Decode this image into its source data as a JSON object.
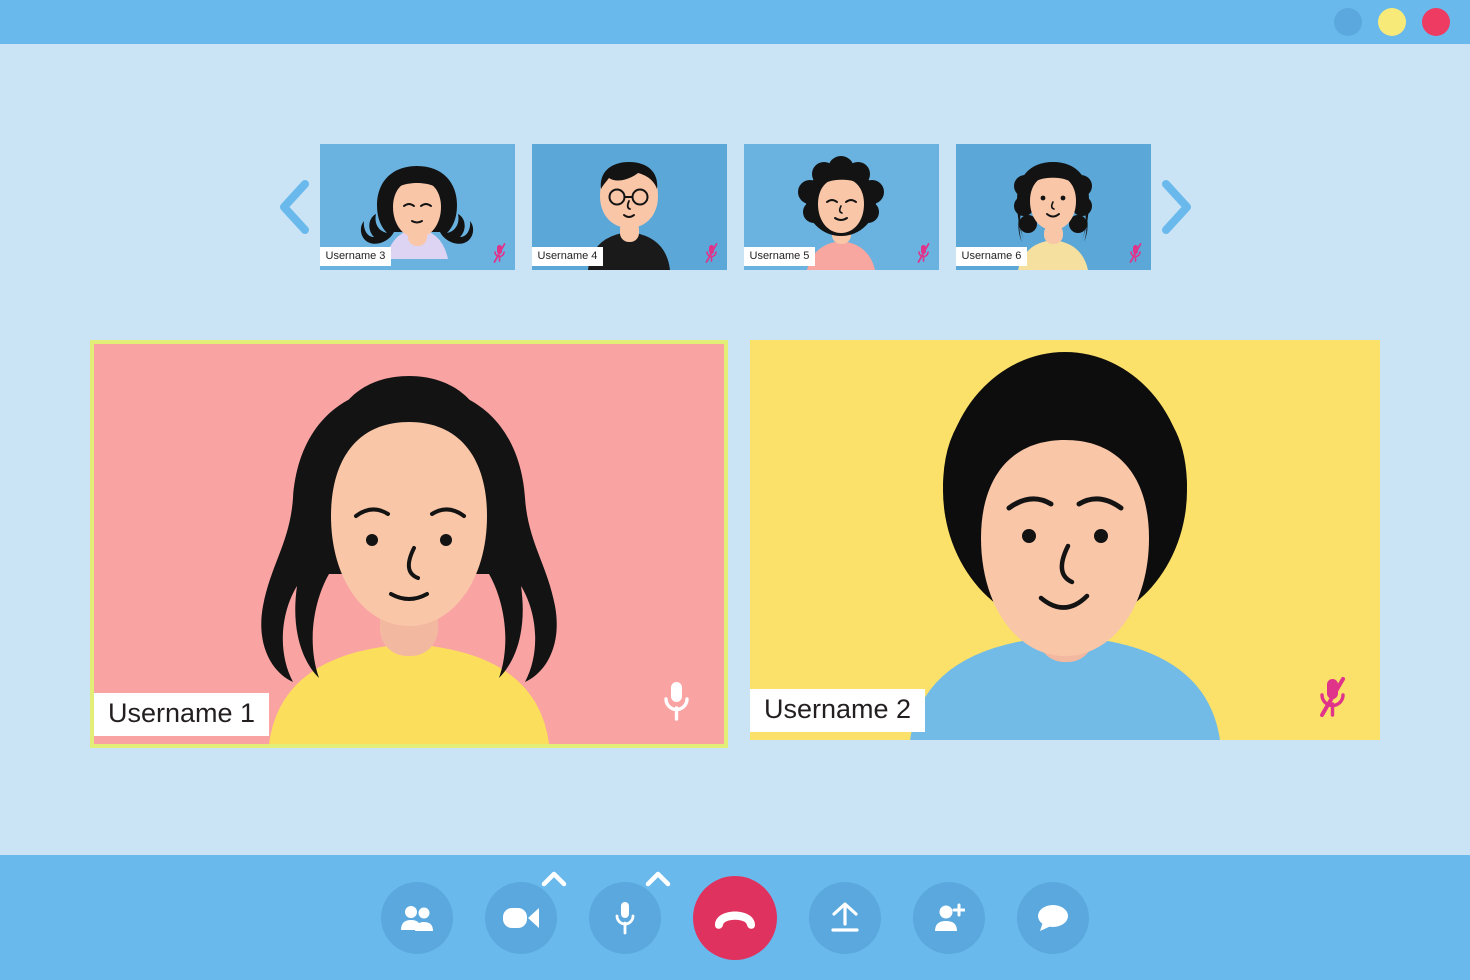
{
  "window": {
    "titlebar_color": "#6ab9ec",
    "body_color": "#cbe4f5",
    "controls": [
      {
        "name": "minimize",
        "color": "#5aa8dd"
      },
      {
        "name": "maximize",
        "color": "#f8ea78"
      },
      {
        "name": "close",
        "color": "#ed3b62"
      }
    ]
  },
  "strip": {
    "prev_label": "chevron-left",
    "next_label": "chevron-right",
    "arrow_color": "#6ab9ec",
    "thumbnails": [
      {
        "label": "Username 3",
        "bg": "#6ab2e0",
        "hair": "curly-long",
        "shirt": "#ddd3f3",
        "eyes": "closed",
        "muted": true
      },
      {
        "label": "Username 4",
        "bg": "#5ba7d8",
        "hair": "short-glasses",
        "shirt": "#1a1a1a",
        "eyes": "open",
        "muted": true
      },
      {
        "label": "Username 5",
        "bg": "#6ab2e0",
        "hair": "afro",
        "shirt": "#f7a7a0",
        "eyes": "closed",
        "muted": true
      },
      {
        "label": "Username 6",
        "bg": "#5ba7d8",
        "hair": "curly-long",
        "shirt": "#f6e0a0",
        "eyes": "open",
        "muted": true
      }
    ]
  },
  "stage": {
    "tiles": [
      {
        "label": "Username 1",
        "bg": "#f9a3a3",
        "shirt": "#fbdf5c",
        "hair": "wavy-long",
        "muted": false,
        "active": true,
        "active_border": "#e2ee78",
        "mic_color": "#ffffff"
      },
      {
        "label": "Username 2",
        "bg": "#fbe06a",
        "shirt": "#71bbe6",
        "hair": "bob",
        "muted": true,
        "active": false,
        "mic_color": "#e0338a"
      }
    ]
  },
  "toolbar": {
    "bg": "#6ab9ec",
    "button_bg": "#5aa8dd",
    "danger_bg": "#e0325f",
    "buttons": [
      {
        "name": "participants",
        "icon": "people-icon",
        "label": "Participants",
        "has_chevron": false
      },
      {
        "name": "camera",
        "icon": "video-camera-icon",
        "label": "Camera",
        "has_chevron": true
      },
      {
        "name": "microphone",
        "icon": "microphone-icon",
        "label": "Microphone",
        "has_chevron": true
      },
      {
        "name": "end-call",
        "icon": "phone-hangup-icon",
        "label": "End call",
        "has_chevron": false
      },
      {
        "name": "share-screen",
        "icon": "upload-arrow-icon",
        "label": "Share screen",
        "has_chevron": false
      },
      {
        "name": "add-participant",
        "icon": "person-add-icon",
        "label": "Add participant",
        "has_chevron": false
      },
      {
        "name": "chat",
        "icon": "chat-bubble-icon",
        "label": "Chat",
        "has_chevron": false
      }
    ]
  }
}
